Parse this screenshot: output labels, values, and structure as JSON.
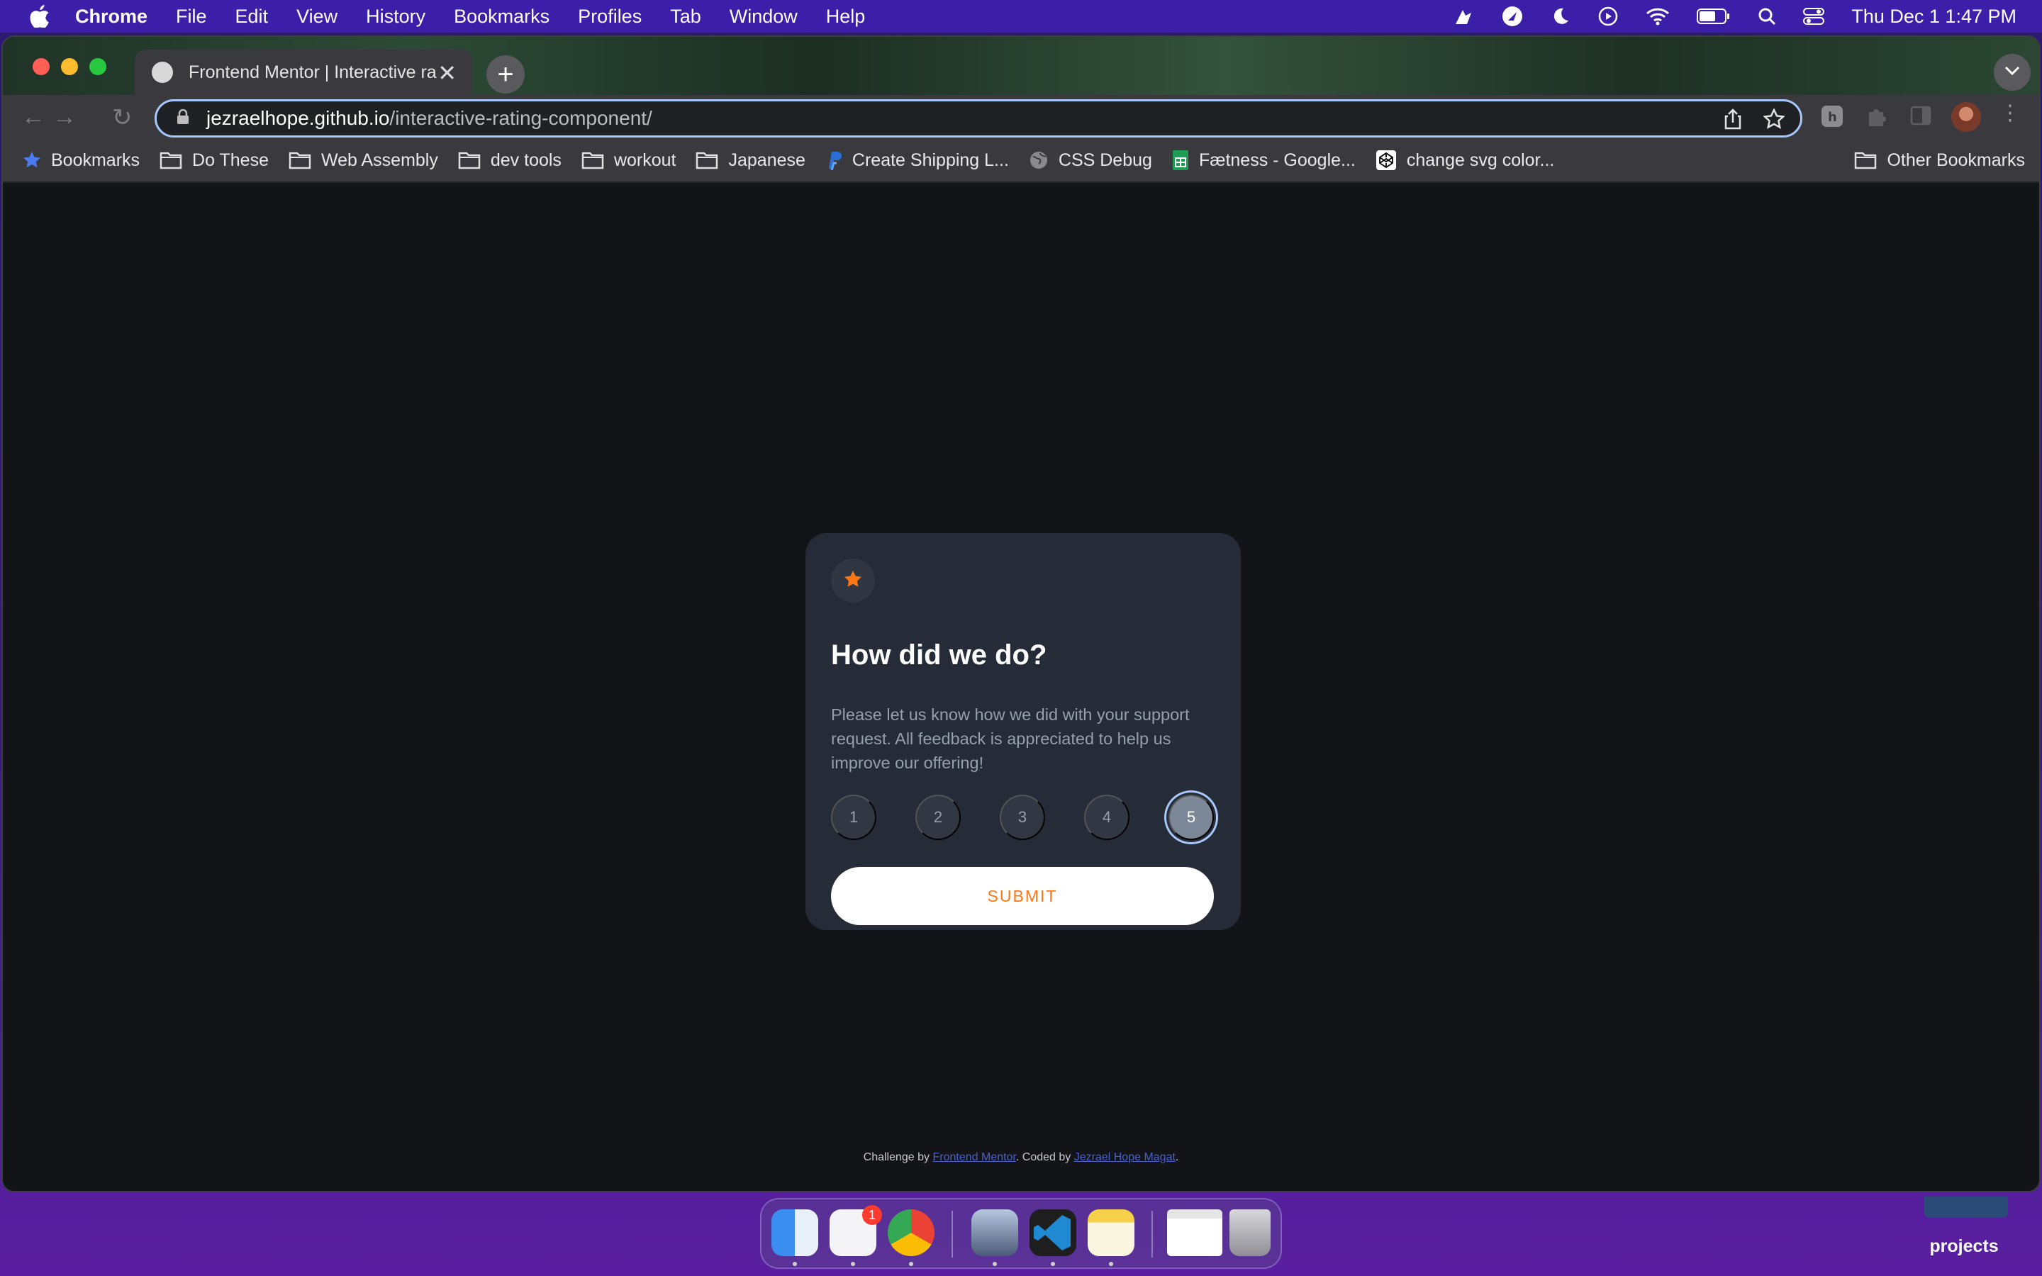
{
  "menubar": {
    "app_name": "Chrome",
    "items": [
      "File",
      "Edit",
      "View",
      "History",
      "Bookmarks",
      "Profiles",
      "Tab",
      "Window",
      "Help"
    ],
    "clock": "Thu Dec 1  1:47 PM"
  },
  "browser": {
    "tab_title": "Frontend Mentor | Interactive ra",
    "tab_close": "✕",
    "new_tab": "+",
    "url_host": "jezraelhope.github.io",
    "url_path": "/interactive-rating-component/",
    "bookmarks": [
      {
        "label": "Bookmarks",
        "icon": "star-icon"
      },
      {
        "label": "Do These",
        "icon": "folder-icon"
      },
      {
        "label": "Web Assembly",
        "icon": "folder-icon"
      },
      {
        "label": "dev tools",
        "icon": "folder-icon"
      },
      {
        "label": "workout",
        "icon": "folder-icon"
      },
      {
        "label": "Japanese",
        "icon": "folder-icon"
      },
      {
        "label": "Create Shipping L...",
        "icon": "paypal-icon"
      },
      {
        "label": "CSS Debug",
        "icon": "globe-icon"
      },
      {
        "label": "Fætness - Google...",
        "icon": "sheets-icon"
      },
      {
        "label": "change svg color...",
        "icon": "codepen-icon"
      }
    ],
    "other_bookmarks": "Other Bookmarks"
  },
  "card": {
    "title": "How did we do?",
    "description": "Please let us know how we did with your support request. All feedback is appreciated to help us improve our offering!",
    "ratings": [
      "1",
      "2",
      "3",
      "4",
      "5"
    ],
    "selected_rating": "5",
    "submit_label": "SUBMIT"
  },
  "attribution": {
    "prefix": "Challenge by ",
    "link1": "Frontend Mentor",
    "middle": ". Coded by ",
    "link2": "Jezrael Hope Magat",
    "suffix": "."
  },
  "dock": {
    "reminders_badge": "1",
    "apps": [
      "finder-icon",
      "reminders-icon",
      "chrome-icon",
      "preview-icon",
      "vscode-icon",
      "notes-icon",
      "chrome-window-icon",
      "trash-icon"
    ]
  },
  "desktop": {
    "folder_label": "projects"
  },
  "colors": {
    "accent_orange": "#fc7614",
    "card_bg": "#252c37",
    "page_bg": "#121417",
    "focus_ring": "#a8c7fa"
  }
}
